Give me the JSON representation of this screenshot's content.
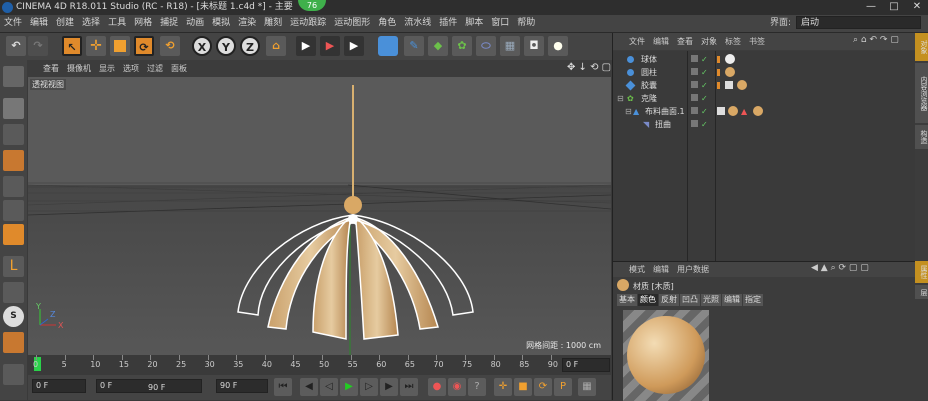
{
  "title_bar": {
    "title": "CINEMA 4D R18.011 Studio (RC - R18) - [未标题 1.c4d *] - 主要",
    "fps": "76",
    "win_min": "—",
    "win_max": "□",
    "win_close": "✕"
  },
  "menu": {
    "items": [
      "文件",
      "编辑",
      "创建",
      "选择",
      "工具",
      "网格",
      "捕捉",
      "动画",
      "模拟",
      "渲染",
      "雕刻",
      "运动跟踪",
      "运动图形",
      "角色",
      "流水线",
      "插件",
      "脚本",
      "窗口",
      "帮助"
    ],
    "layout_label": "界面:",
    "layout_value": "启动"
  },
  "toolbar": {
    "x_label": "X",
    "y_label": "Y",
    "z_label": "Z"
  },
  "viewport": {
    "menu": [
      "查看",
      "摄像机",
      "显示",
      "选项",
      "过滤",
      "面板"
    ],
    "view_label": "透视视图",
    "grid_spacing": "网格间距 : 1000 cm",
    "axis_y": "Y",
    "axis_x": "X",
    "axis_z": "Z"
  },
  "timeline": {
    "ticks": [
      "0",
      "5",
      "10",
      "15",
      "20",
      "25",
      "30",
      "35",
      "40",
      "45",
      "50",
      "55",
      "60",
      "65",
      "70",
      "75",
      "80",
      "85",
      "90"
    ],
    "end_frame": "0 F"
  },
  "transport": {
    "field1": "0 F",
    "field2": "0 F",
    "field3": "90 F",
    "field4": "90 F"
  },
  "object_manager": {
    "menu": [
      "文件",
      "编辑",
      "查看",
      "对象",
      "标签",
      "书签"
    ],
    "objects": [
      {
        "name": "球体",
        "indent": 0
      },
      {
        "name": "圆柱",
        "indent": 0
      },
      {
        "name": "胶囊",
        "indent": 0
      },
      {
        "name": "克隆",
        "indent": 0
      },
      {
        "name": "布料曲面.1",
        "indent": 1
      },
      {
        "name": "扭曲",
        "indent": 2
      }
    ],
    "side_tabs": [
      "对象",
      "内容浏览器",
      "构造"
    ]
  },
  "attribute_manager": {
    "menu": [
      "模式",
      "编辑",
      "用户数据"
    ],
    "material_title": "材质 [木质]",
    "tabs": [
      "基本",
      "颜色",
      "反射",
      "凹凸",
      "光照",
      "编辑",
      "指定"
    ],
    "active_tab": "颜色",
    "side_tabs": [
      "属性",
      "层"
    ]
  }
}
